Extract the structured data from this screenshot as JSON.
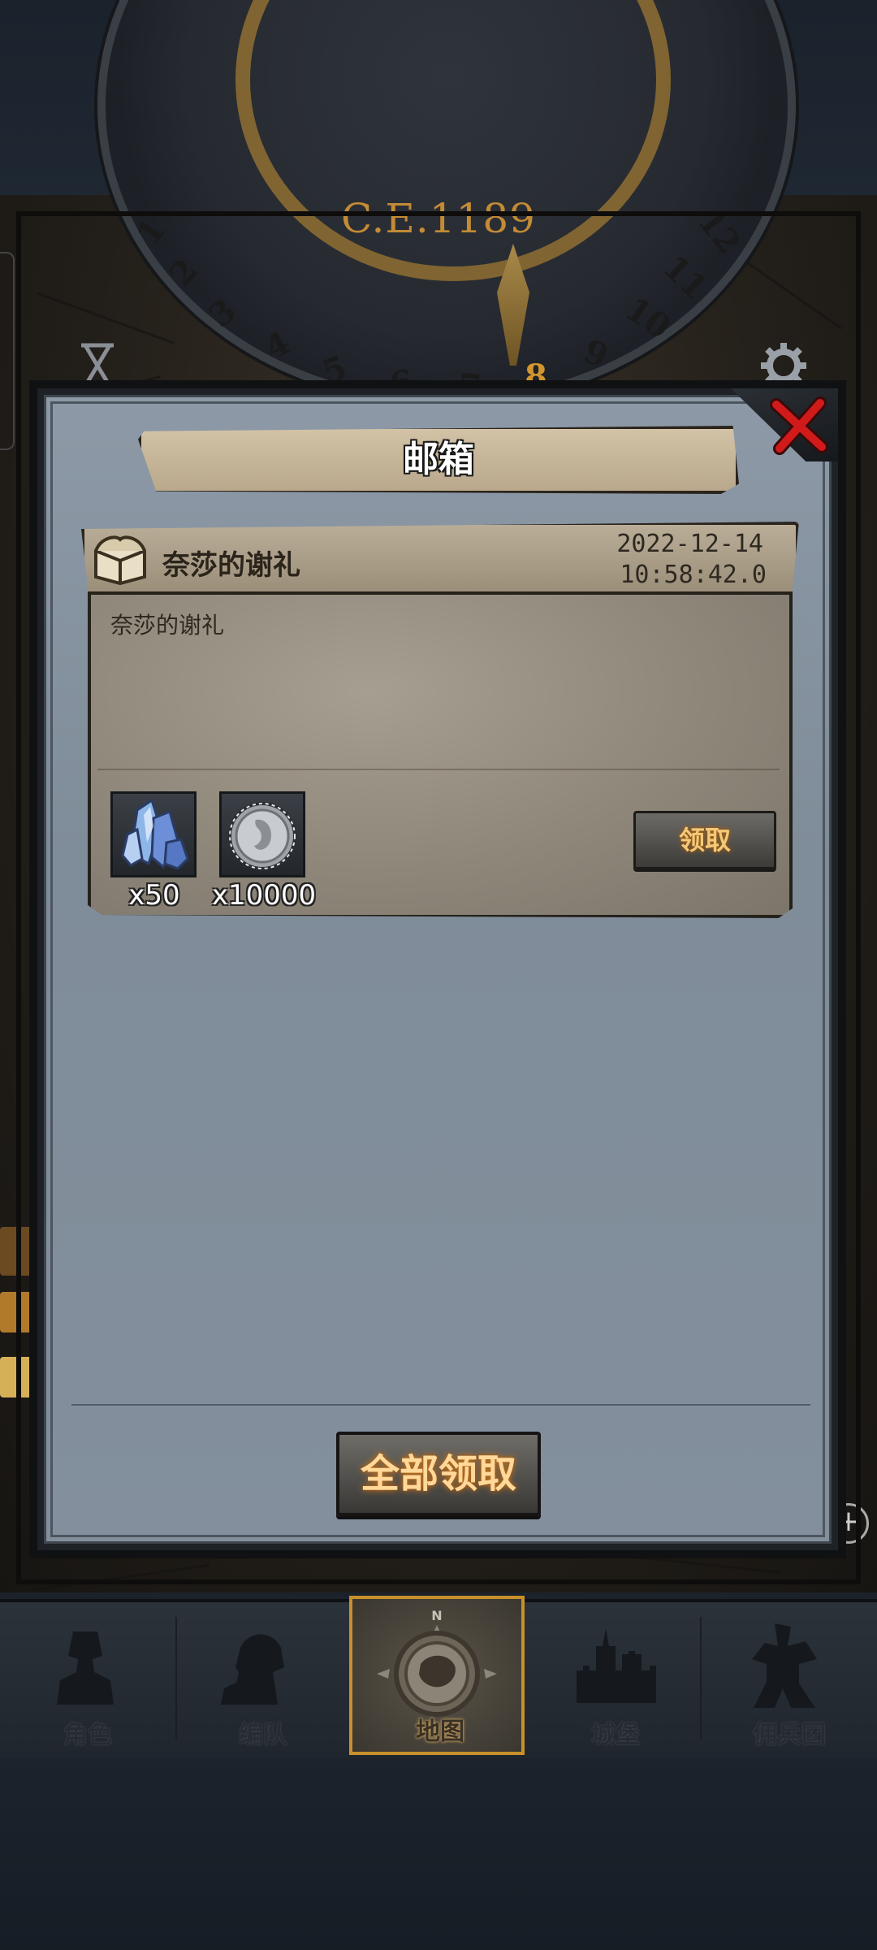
{
  "era": "C.E.1189",
  "dial_numbers": [
    "1",
    "2",
    "3",
    "4",
    "5",
    "6",
    "7",
    "8",
    "9",
    "10",
    "11",
    "12"
  ],
  "modal": {
    "title": "邮箱"
  },
  "mail": {
    "subject": "奈莎的谢礼",
    "date": "2022-12-14",
    "time": "10:58:42.0",
    "content": "奈莎的谢礼",
    "rewards": [
      {
        "icon": "crystal-icon",
        "quantity": "x50"
      },
      {
        "icon": "silver-coin-icon",
        "quantity": "x10000"
      }
    ],
    "claim_label": "领取"
  },
  "claim_all_label": "全部领取",
  "nav": {
    "items": [
      {
        "label": "角色",
        "icon": "knight-icon"
      },
      {
        "label": "编队",
        "icon": "squad-icon"
      },
      {
        "label": "地图",
        "icon": "compass-map-icon",
        "active": true
      },
      {
        "label": "城堡",
        "icon": "castle-icon"
      },
      {
        "label": "佣兵团",
        "icon": "mercenary-icon"
      }
    ]
  },
  "colors": {
    "accent_gold": "#c8902a",
    "claim_text": "#f2c97a",
    "close_red": "#d11a1a"
  }
}
